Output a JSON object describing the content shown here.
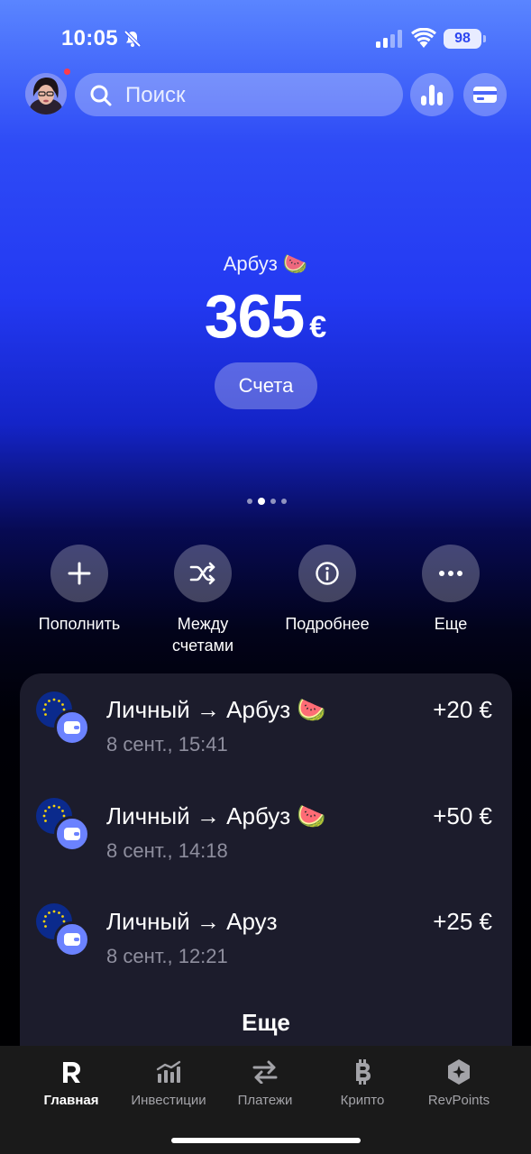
{
  "status_bar": {
    "time": "10:05",
    "battery": "98"
  },
  "header": {
    "search_placeholder": "Поиск"
  },
  "balance": {
    "label": "Арбуз 🍉",
    "amount": "365",
    "currency": "€",
    "accounts_button": "Счета"
  },
  "pager": {
    "pages": 4,
    "active": 1
  },
  "actions": [
    {
      "label": "Пополнить",
      "icon": "plus-icon"
    },
    {
      "label": "Между счетами",
      "icon": "shuffle-icon"
    },
    {
      "label": "Подробнее",
      "icon": "info-icon"
    },
    {
      "label": "Еще",
      "icon": "more-dots-icon"
    }
  ],
  "transactions": [
    {
      "title": "Личный → Арбуз 🍉",
      "date": "8 сент., 15:41",
      "amount": "+20 €"
    },
    {
      "title": "Личный → Арбуз 🍉",
      "date": "8 сент., 14:18",
      "amount": "+50 €"
    },
    {
      "title": "Личный → Аруз",
      "date": "8 сент., 12:21",
      "amount": "+25 €"
    }
  ],
  "transactions_more": "Еще",
  "tabs": [
    {
      "label": "Главная",
      "icon": "revolut-r-icon",
      "active": true
    },
    {
      "label": "Инвестиции",
      "icon": "stocks-chart-icon",
      "active": false
    },
    {
      "label": "Платежи",
      "icon": "transfer-arrows-icon",
      "active": false
    },
    {
      "label": "Крипто",
      "icon": "bitcoin-icon",
      "active": false
    },
    {
      "label": "RevPoints",
      "icon": "revpoints-hex-icon",
      "active": false
    }
  ],
  "colors": {
    "accent": "#2339f2",
    "card": "#1c1c2c",
    "wallet": "#6b82ff",
    "notification": "#ff3b4a"
  }
}
